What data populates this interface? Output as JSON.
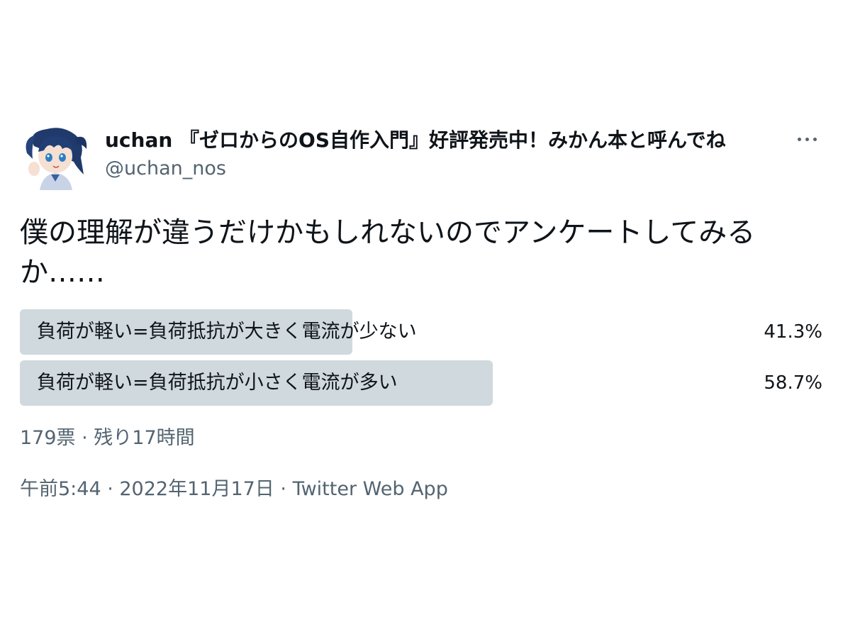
{
  "author": {
    "display_name": "uchan 『ゼロからのOS自作入門』好評発売中！みかん本と呼んでね",
    "handle": "@uchan_nos",
    "avatar_icon": "anime-character-avatar"
  },
  "more_icon": "ellipsis-icon",
  "tweet_text": "僕の理解が違うだけかもしれないのでアンケートしてみるか……",
  "poll": {
    "options": [
      {
        "label": "負荷が軽い=負荷抵抗が大きく電流が少ない",
        "percent_text": "41.3%",
        "percent": 41.3
      },
      {
        "label": "負荷が軽い=負荷抵抗が小さく電流が多い",
        "percent_text": "58.7%",
        "percent": 58.7
      }
    ],
    "votes_text": "179票 · 残り17時間"
  },
  "timestamp": {
    "time_date": "午前5:44 · 2022年11月17日 · ",
    "source": "Twitter Web App"
  },
  "colors": {
    "text": "#0f1419",
    "secondary": "#536471",
    "poll_fill": "#cfd9de"
  }
}
